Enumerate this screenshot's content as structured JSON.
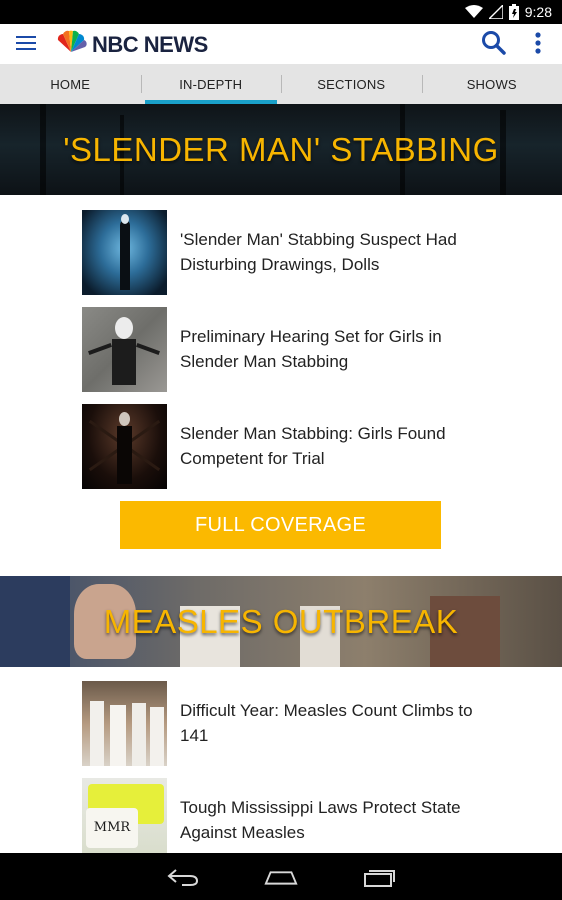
{
  "status_bar": {
    "time": "9:28"
  },
  "app": {
    "brand": "NBC NEWS"
  },
  "tabs": [
    {
      "label": "HOME"
    },
    {
      "label": "IN-DEPTH"
    },
    {
      "label": "SECTIONS"
    },
    {
      "label": "SHOWS"
    }
  ],
  "sections": [
    {
      "title": "'SLENDER MAN' STABBING",
      "articles": [
        {
          "headline": "'Slender Man' Stabbing Suspect Had Disturbing Drawings, Dolls"
        },
        {
          "headline": "Preliminary Hearing Set for Girls in Slender Man Stabbing"
        },
        {
          "headline": "Slender Man Stabbing: Girls Found Competent for Trial"
        }
      ],
      "button_label": "FULL COVERAGE"
    },
    {
      "title": "MEASLES OUTBREAK",
      "articles": [
        {
          "headline": "Difficult Year: Measles Count Climbs to 141"
        },
        {
          "headline": "Tough Mississippi Laws Protect State Against Measles",
          "thumb_text": "MMR"
        }
      ]
    }
  ],
  "colors": {
    "accent_gold": "#f7b500",
    "button_gold": "#fbb900",
    "tab_indicator": "#1aa0c9",
    "icon_blue": "#1b4aa8"
  },
  "icons": [
    "wifi-icon",
    "signal-icon",
    "battery-icon",
    "menu-icon",
    "peacock-logo-icon",
    "search-icon",
    "overflow-menu-icon",
    "back-icon",
    "home-icon",
    "recent-apps-icon"
  ]
}
